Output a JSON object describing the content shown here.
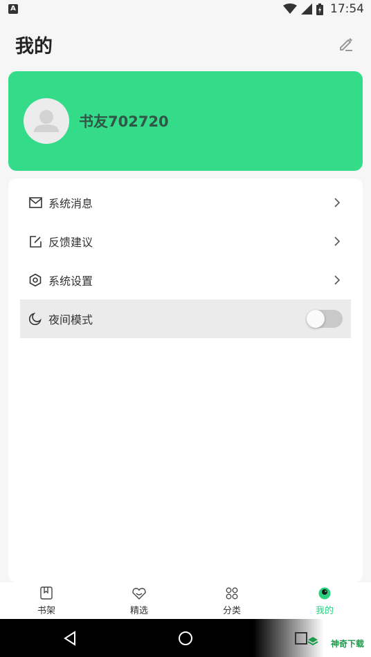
{
  "status_bar": {
    "notification_icon": "A",
    "time": "17:54",
    "icons": [
      "wifi-icon",
      "signal-icon",
      "battery-icon"
    ]
  },
  "header": {
    "title": "我的",
    "edit_icon": "edit-icon"
  },
  "profile": {
    "username": "书友702720",
    "card_color": "#34db88"
  },
  "menu": {
    "items": [
      {
        "label": "系统消息",
        "icon": "mail-icon"
      },
      {
        "label": "反馈建议",
        "icon": "feedback-icon"
      },
      {
        "label": "系统设置",
        "icon": "settings-icon"
      },
      {
        "label": "夜间模式",
        "icon": "moon-icon",
        "toggle": false
      }
    ]
  },
  "bottom_nav": {
    "items": [
      {
        "label": "书架",
        "icon": "bookshelf-icon",
        "active": false
      },
      {
        "label": "精选",
        "icon": "featured-icon",
        "active": false
      },
      {
        "label": "分类",
        "icon": "category-icon",
        "active": false
      },
      {
        "label": "我的",
        "icon": "profile-icon",
        "active": true
      }
    ],
    "active_color": "#2bd07f"
  },
  "watermark": {
    "text": "神奇下载"
  }
}
